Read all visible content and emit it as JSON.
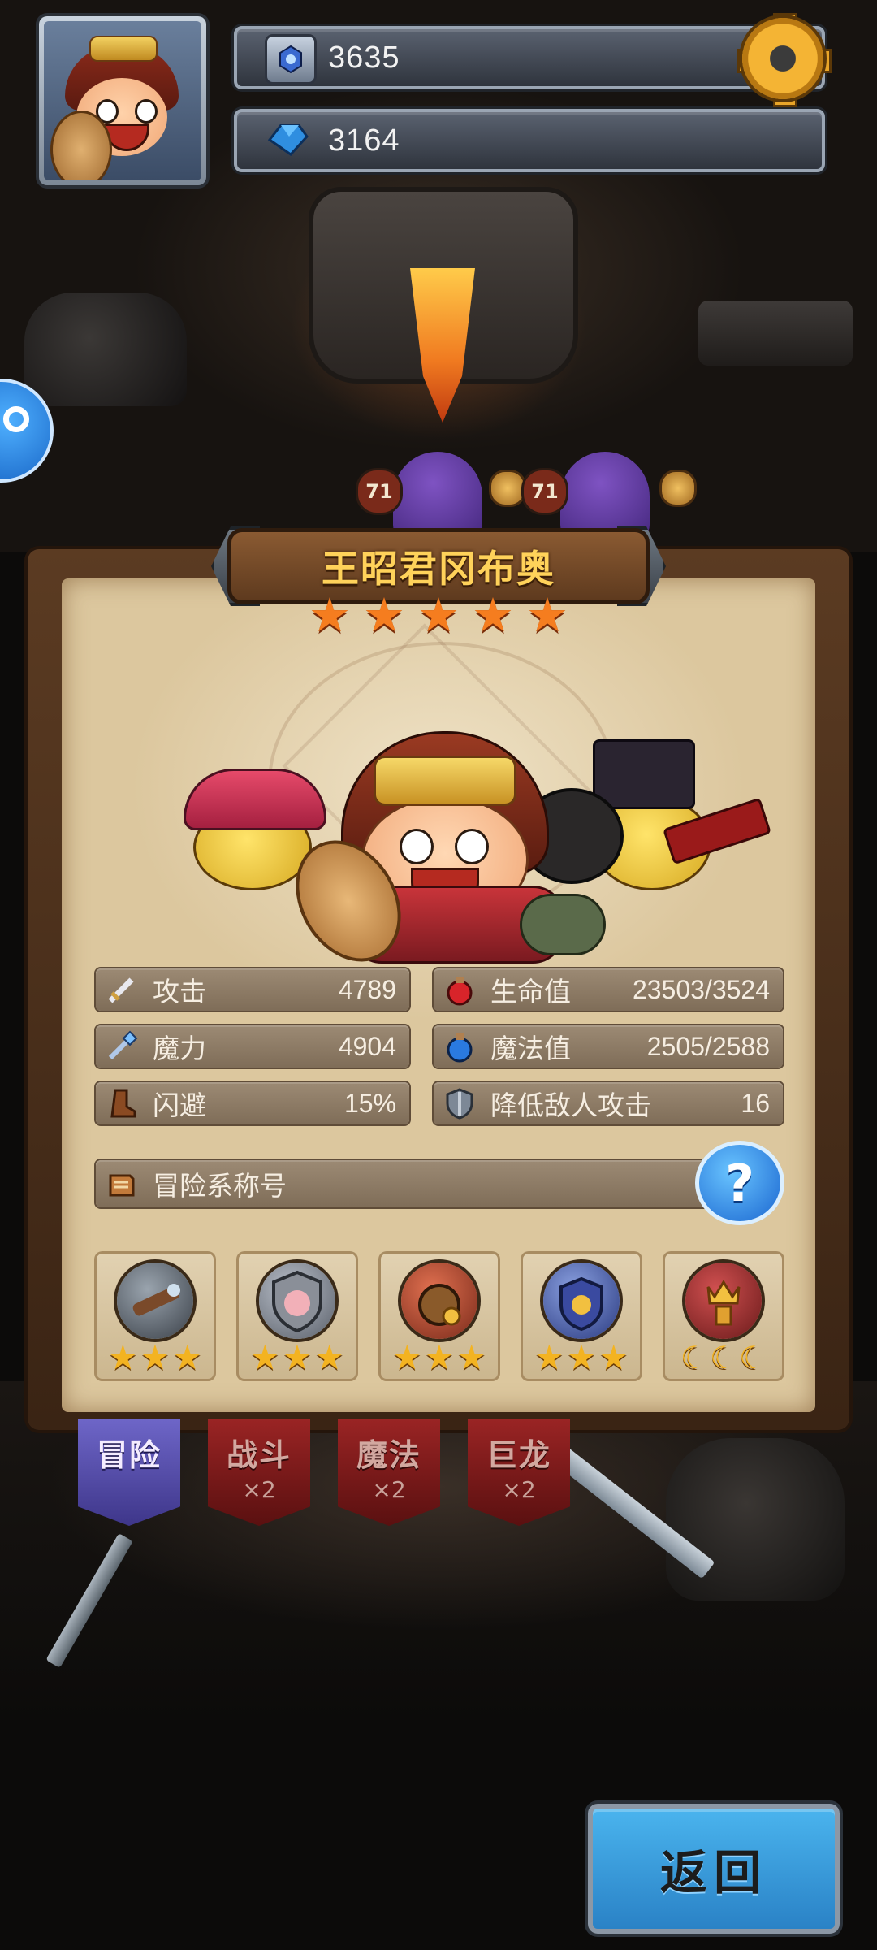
{
  "resources": {
    "gems": "3635",
    "crystals": "3164"
  },
  "hero": {
    "name": "王昭君冈布奥",
    "star_count": 5
  },
  "stats": {
    "attack_label": "攻击",
    "attack_value": "4789",
    "hp_label": "生命值",
    "hp_value": "23503/3524",
    "magic_label": "魔力",
    "magic_value": "4904",
    "mp_label": "魔法值",
    "mp_value": "2505/2588",
    "dodge_label": "闪避",
    "dodge_value": "15%",
    "reduce_attack_label": "降低敌人攻击",
    "reduce_attack_value": "16"
  },
  "title_bar": {
    "label": "冒险系称号",
    "help_glyph": "?"
  },
  "badges": [
    {
      "icon": "spyglass-icon",
      "color": "#6a5040"
    },
    {
      "icon": "shield-portrait-icon",
      "color": "#7a7e88"
    },
    {
      "icon": "coin-bag-icon",
      "color": "#a04a2a"
    },
    {
      "icon": "laurel-gold-icon",
      "color": "#5a6aa0"
    },
    {
      "icon": "crown-trophy-icon",
      "color": "#8a2a2a"
    }
  ],
  "tabs": [
    {
      "label": "冒险",
      "multiplier": ""
    },
    {
      "label": "战斗",
      "multiplier": "×2"
    },
    {
      "label": "魔法",
      "multiplier": "×2"
    },
    {
      "label": "巨龙",
      "multiplier": "×2"
    }
  ],
  "scene": {
    "enemy_level_1": "71",
    "enemy_level_2": "71"
  },
  "back_button": {
    "label": "返回"
  },
  "colors": {
    "star": "#f57d1f",
    "hero_name": "#ffd25a",
    "back_button": "#3aa0e0"
  }
}
